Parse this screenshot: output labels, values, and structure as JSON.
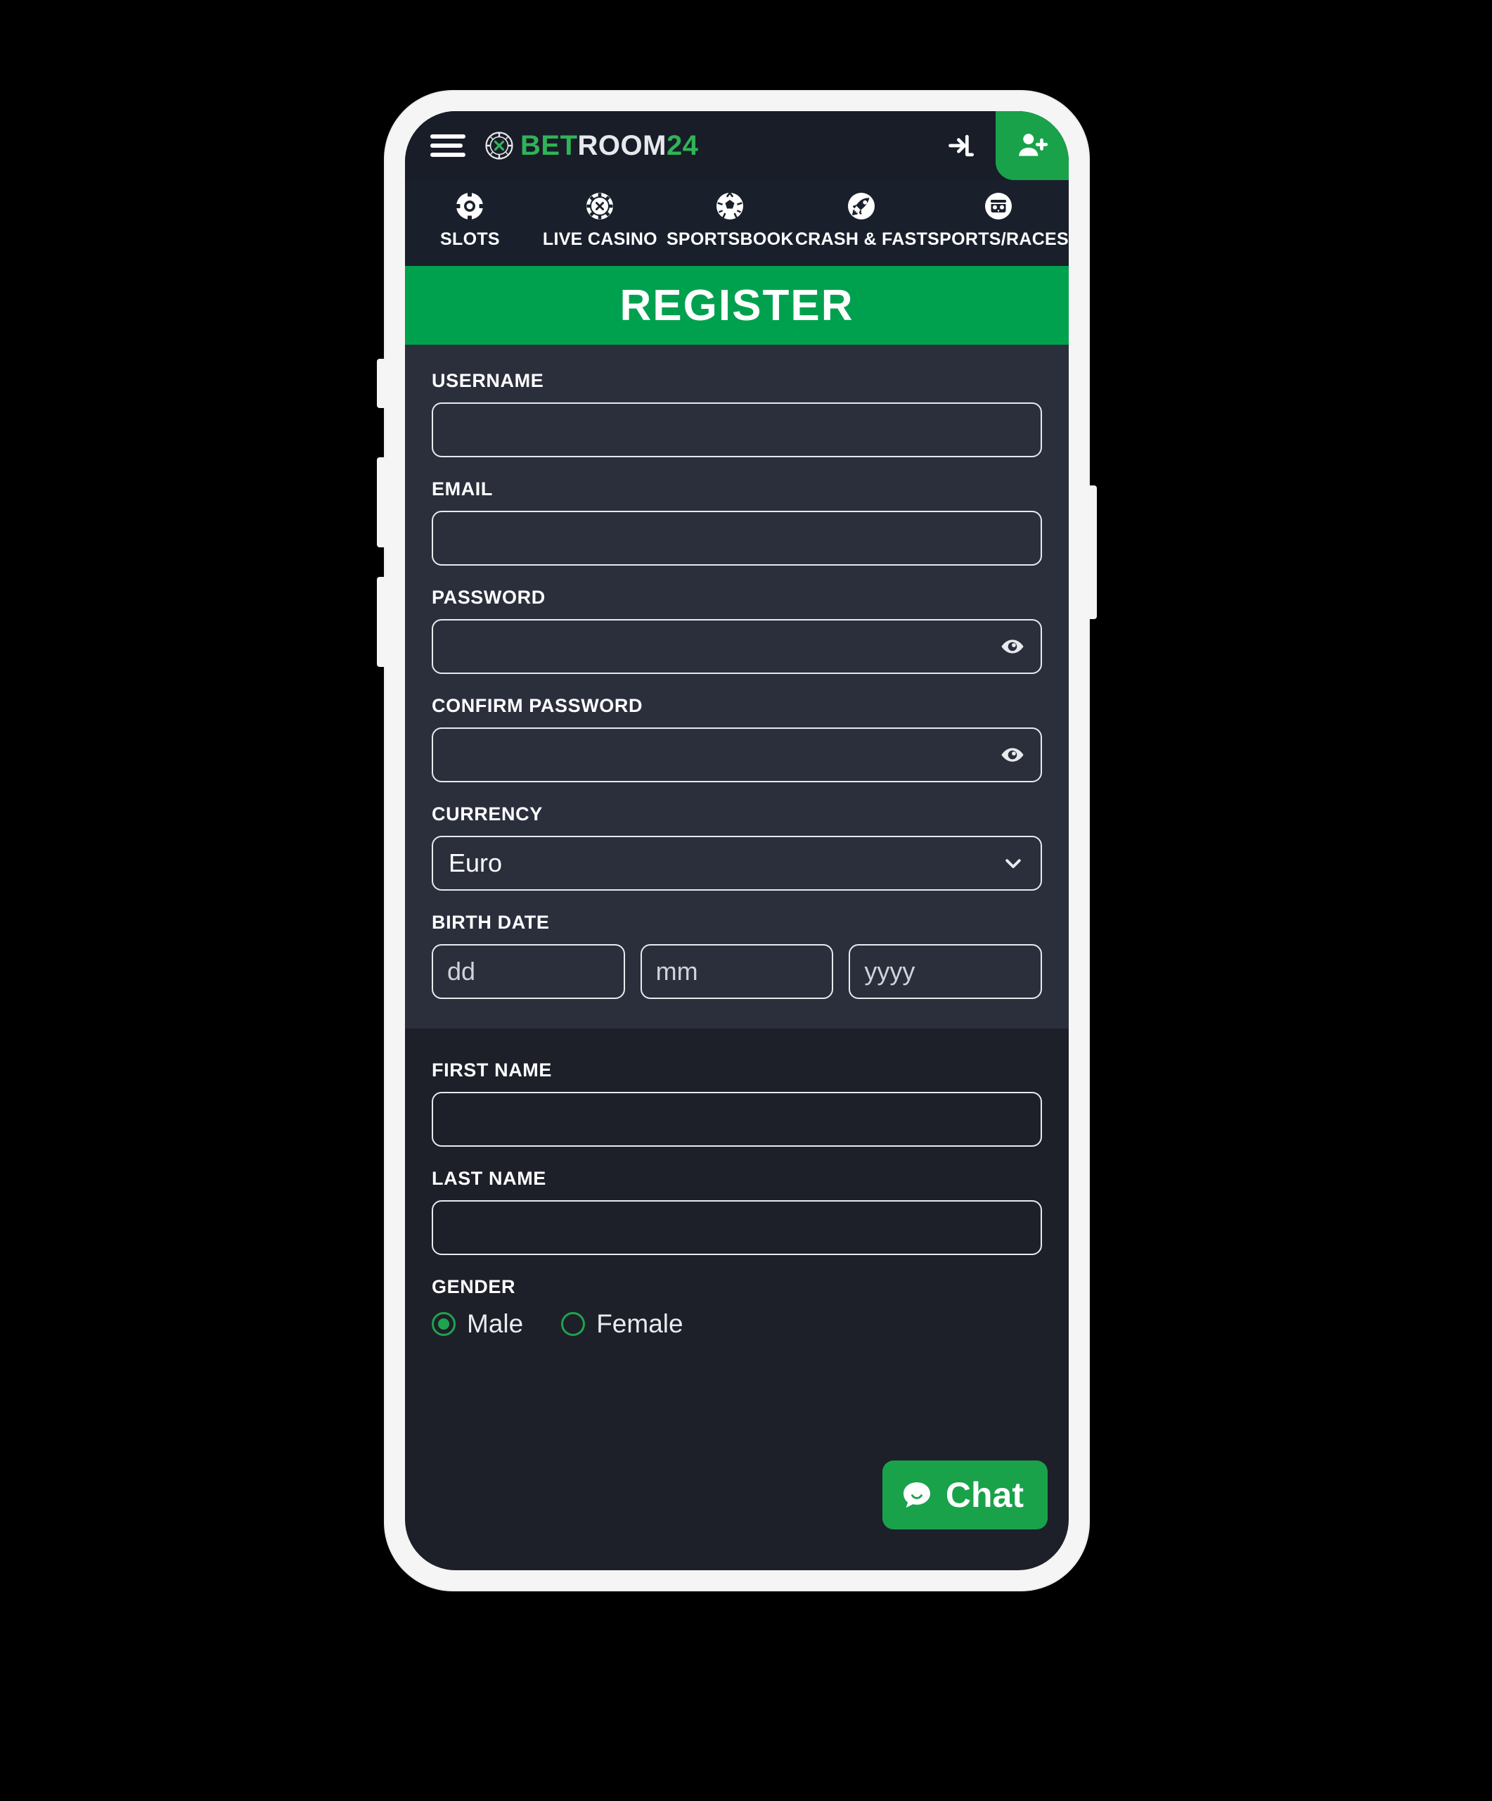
{
  "brand": {
    "logo_bet": "BET",
    "logo_room": "ROOM",
    "logo_24": "24",
    "chip_icon": "casino-chip-icon",
    "accent_green": "#00a14e",
    "header_bg": "#181d28",
    "nav_bg": "#1a202b",
    "section_a_bg": "#2b2f3c",
    "section_b_bg": "#1d2029"
  },
  "topbar": {
    "menu_icon": "hamburger-menu-icon",
    "login_icon": "login-arrow-icon",
    "register_icon": "person-add-icon"
  },
  "nav": {
    "items": [
      {
        "label": "SLOTS",
        "icon": "casino-chip-icon"
      },
      {
        "label": "LIVE CASINO",
        "icon": "poker-chip-icon"
      },
      {
        "label": "SPORTSBOOK",
        "icon": "soccer-ball-icon"
      },
      {
        "label": "CRASH & FAST",
        "icon": "rocket-icon"
      },
      {
        "label": "SPORTS/RACES",
        "icon": "virtual-races-icon"
      }
    ]
  },
  "page": {
    "title": "REGISTER"
  },
  "form": {
    "username": {
      "label": "USERNAME",
      "value": "",
      "placeholder": ""
    },
    "email": {
      "label": "EMAIL",
      "value": "",
      "placeholder": ""
    },
    "password": {
      "label": "PASSWORD",
      "value": "",
      "placeholder": "",
      "toggle_icon": "eye-icon"
    },
    "confirm_password": {
      "label": "CONFIRM PASSWORD",
      "value": "",
      "placeholder": "",
      "toggle_icon": "eye-icon"
    },
    "currency": {
      "label": "CURRENCY",
      "selected": "Euro",
      "options": [
        "Euro"
      ],
      "chevron_icon": "chevron-down-icon"
    },
    "birth_date": {
      "label": "BIRTH DATE",
      "day": {
        "value": "",
        "placeholder": "dd"
      },
      "month": {
        "value": "",
        "placeholder": "mm"
      },
      "year": {
        "value": "",
        "placeholder": "yyyy"
      }
    },
    "first_name": {
      "label": "FIRST NAME",
      "value": "",
      "placeholder": ""
    },
    "last_name": {
      "label": "LAST NAME",
      "value": "",
      "placeholder": ""
    },
    "gender": {
      "label": "GENDER",
      "options": [
        {
          "label": "Male",
          "checked": true
        },
        {
          "label": "Female",
          "checked": false
        }
      ]
    }
  },
  "chat": {
    "label": "Chat",
    "icon": "chat-bubble-icon"
  }
}
